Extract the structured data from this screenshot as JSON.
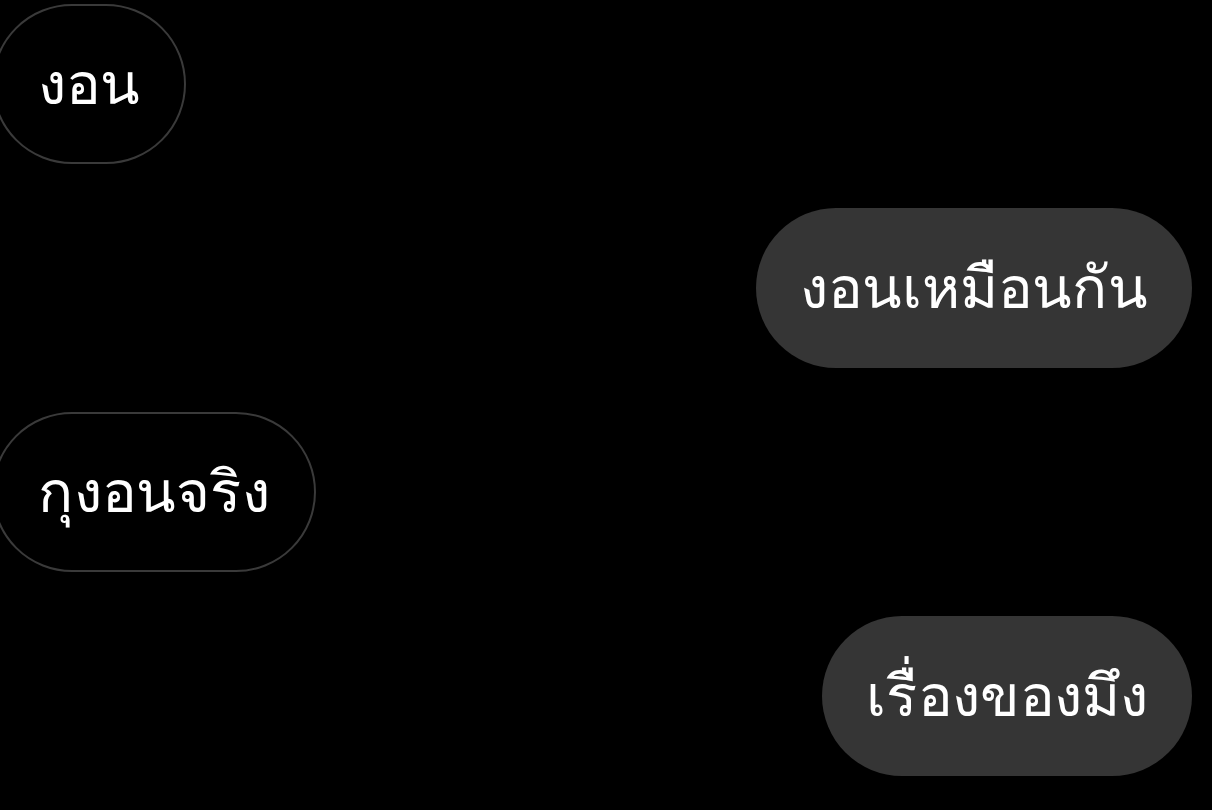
{
  "messages": [
    {
      "kind": "incoming",
      "text": "งอน"
    },
    {
      "kind": "outgoing",
      "text": "งอนเหมือนกัน"
    },
    {
      "kind": "incoming",
      "text": "กุงอนจริง"
    },
    {
      "kind": "outgoing",
      "text": "เรื่องของมึง"
    }
  ]
}
